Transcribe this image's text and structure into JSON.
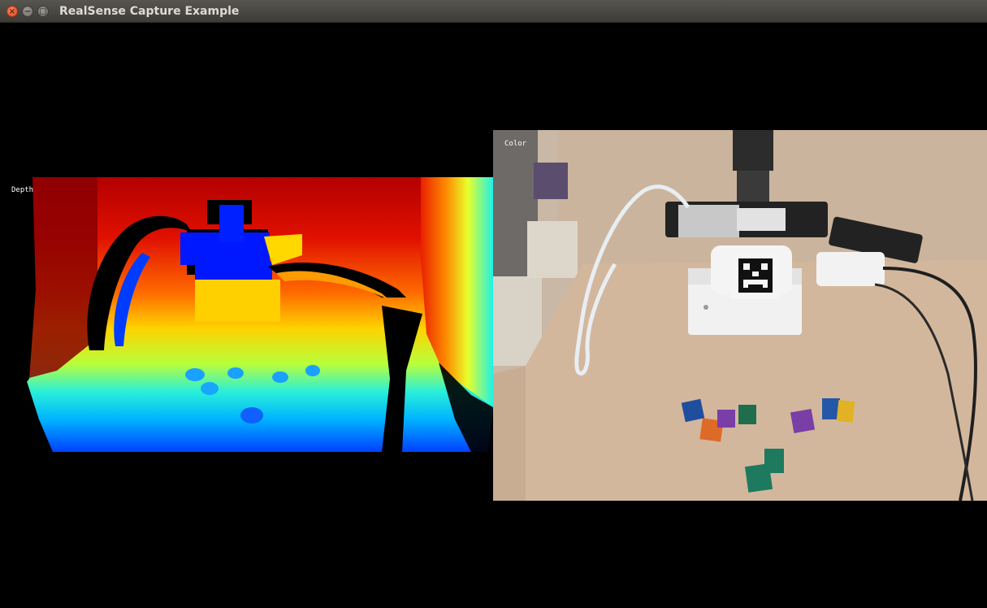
{
  "window": {
    "title": "RealSense Capture Example",
    "buttons": {
      "close_glyph": "×",
      "minimize_glyph": "−",
      "maximize_glyph": "□"
    }
  },
  "depth_view": {
    "label": "Depth",
    "colormap": "jet"
  },
  "color_view": {
    "label": "Color",
    "marker_icon": "aruco-marker-icon"
  },
  "colors": {
    "titlebar": "#3c3b37",
    "title_text": "#dfdbd2",
    "close_button": "#e95420",
    "background": "#000000",
    "label_text": "#ffffff"
  }
}
